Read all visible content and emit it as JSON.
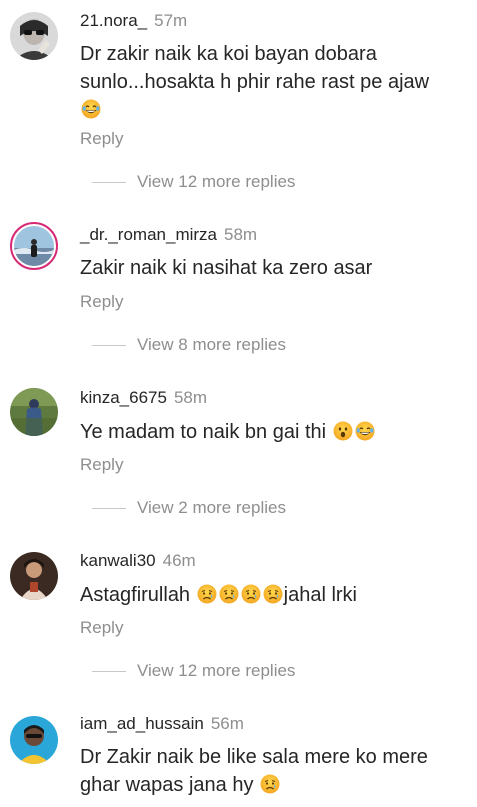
{
  "comments": [
    {
      "username": "21.nora_",
      "time": "57m",
      "text": "Dr zakir naik ka koi bayan dobara sunlo...hosakta h phir rahe rast pe ajaw",
      "emojis": [
        "laughing-tears"
      ],
      "reply_label": "Reply",
      "view_more": "View 12 more replies"
    },
    {
      "username": "_dr._roman_mirza",
      "time": "58m",
      "text": "Zakir naik ki nasihat ka zero asar",
      "emojis": [],
      "reply_label": "Reply",
      "view_more": "View 8 more replies"
    },
    {
      "username": "kinza_6675",
      "time": "58m",
      "text": "Ye madam to naik bn gai thi",
      "emojis": [
        "surprised",
        "laughing-tears"
      ],
      "reply_label": "Reply",
      "view_more": "View 2 more replies"
    },
    {
      "username": "kanwali30",
      "time": "46m",
      "text_before": "Astagfirullah",
      "text_after": "jahal lrki",
      "emojis": [
        "sad-tear",
        "sad-tear",
        "sad-tear",
        "sad-tear"
      ],
      "reply_label": "Reply",
      "view_more": "View 12 more replies"
    },
    {
      "username": "iam_ad_hussain",
      "time": "56m",
      "text": "Dr Zakir naik be like sala mere ko  mere ghar wapas jana hy",
      "emojis": [
        "sad-tear"
      ]
    }
  ],
  "colors": {
    "text": "#262626",
    "secondary": "#8e8e8e",
    "story_ring": "#d62976",
    "divider": "#c7c7c7"
  }
}
